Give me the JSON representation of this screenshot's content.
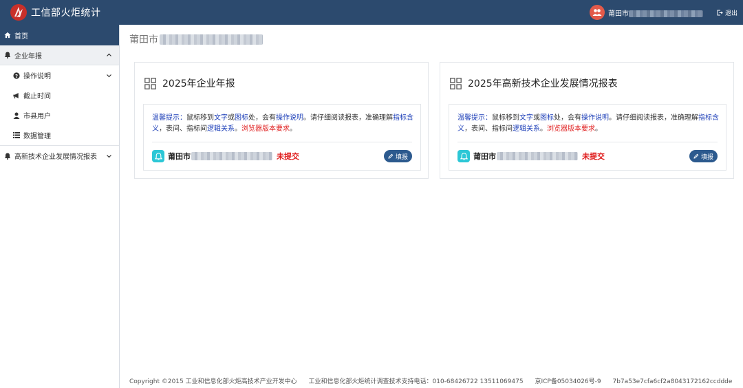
{
  "header": {
    "app_title": "工信部火炬统计",
    "user_prefix": "莆田市",
    "logout_label": "退出"
  },
  "sidebar": {
    "items": [
      {
        "label": "首页",
        "icon": "home-icon"
      },
      {
        "label": "企业年报",
        "icon": "bell-icon"
      },
      {
        "label": "操作说明",
        "icon": "question-circle-icon"
      },
      {
        "label": "截止时间",
        "icon": "megaphone-icon"
      },
      {
        "label": "市县用户",
        "icon": "user-icon"
      },
      {
        "label": "数据管理",
        "icon": "list-icon"
      },
      {
        "label": "高新技术企业发展情况报表",
        "icon": "bell-icon"
      }
    ]
  },
  "main": {
    "breadcrumb_prefix": "莆田市",
    "cards": [
      {
        "title": "2025年企业年报",
        "org_prefix": "莆田市",
        "status": "未提交",
        "button": "填报"
      },
      {
        "title": "2025年高新技术企业发展情况报表",
        "org_prefix": "莆田市",
        "status": "未提交",
        "button": "填报"
      }
    ],
    "tip": {
      "label": "温馨提示",
      "colon": "：",
      "t1": "鼠标移到",
      "word1": "文字",
      "t2": "或",
      "word2": "图标",
      "t3": "处，会有",
      "word3": "操作说明",
      "t4": "。请仔细阅读报表，准确理解",
      "word4": "指标含义",
      "t5": "，表间、指标间",
      "word5": "逻辑关系",
      "t6": "。",
      "word6": "浏览器版本要求",
      "t7": "。"
    }
  },
  "footer": {
    "copyright": "Copyright ©2015 工业和信息化部火炬高技术产业开发中心",
    "support": "工业和信息化部火炬统计调查技术支持电话：010-68426722 13511069475",
    "icp": "京ICP备05034026号-9",
    "hash": "7b7a53e7cfa6cf2a8043172162ccddde"
  },
  "colors": {
    "header_bg": "#2c4a6e",
    "link_blue": "#1d3fb8",
    "alert_red": "#e02020",
    "bell_teal": "#2cc7d6",
    "button_blue": "#2c5a8e",
    "avatar_red": "#e35a4a"
  }
}
